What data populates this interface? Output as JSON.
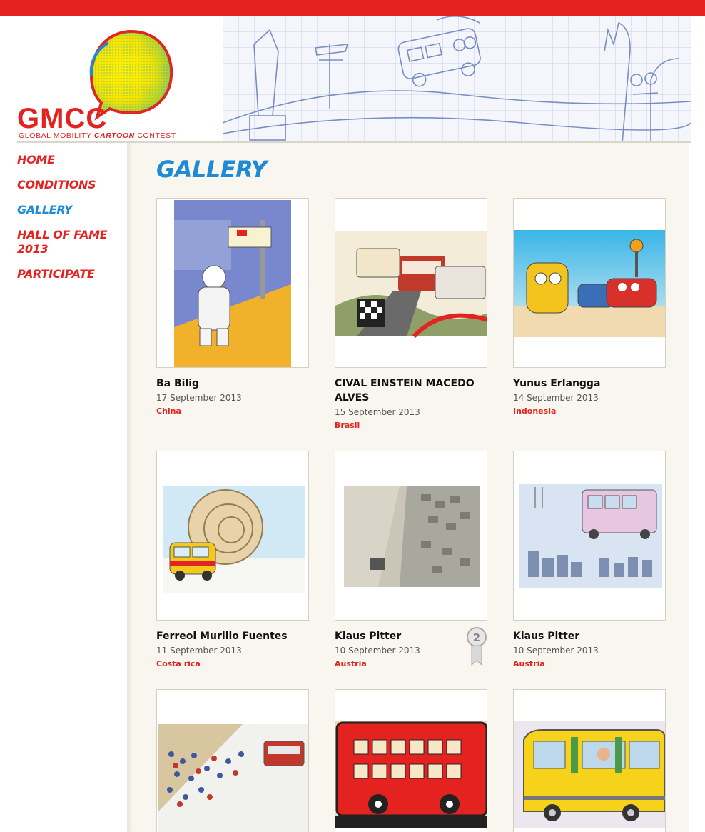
{
  "logo": {
    "text": "GMCC",
    "subtitle_pre": "GLOBAL MOBILITY",
    "subtitle_bold": "CARTOON",
    "subtitle_post": "CONTEST"
  },
  "nav": {
    "items": [
      {
        "label": "HOME"
      },
      {
        "label": "CONDITIONS"
      },
      {
        "label": "GALLERY",
        "active": true
      },
      {
        "label": "HALL OF FAME 2013"
      },
      {
        "label": "PARTICIPATE"
      }
    ]
  },
  "page_title": "GALLERY",
  "gallery": [
    {
      "name": "Ba Bilig",
      "date": "17 September 2013",
      "country": "China"
    },
    {
      "name": "CIVAL EINSTEIN MACEDO ALVES",
      "date": "15 September 2013",
      "country": "Brasil"
    },
    {
      "name": "Yunus Erlangga",
      "date": "14 September 2013",
      "country": "Indonesia"
    },
    {
      "name": "Ferreol Murillo Fuentes",
      "date": "11 September 2013",
      "country": "Costa rica"
    },
    {
      "name": "Klaus Pitter",
      "date": "10 September 2013",
      "country": "Austria",
      "award": "award-2nd-icon"
    },
    {
      "name": "Klaus Pitter",
      "date": "10 September 2013",
      "country": "Austria"
    },
    {
      "name": "",
      "date": "",
      "country": ""
    },
    {
      "name": "",
      "date": "",
      "country": ""
    },
    {
      "name": "",
      "date": "",
      "country": ""
    }
  ],
  "colors": {
    "brand_red": "#e42320",
    "accent_blue": "#1f8ad6",
    "panel_bg": "#f8f6ee"
  }
}
